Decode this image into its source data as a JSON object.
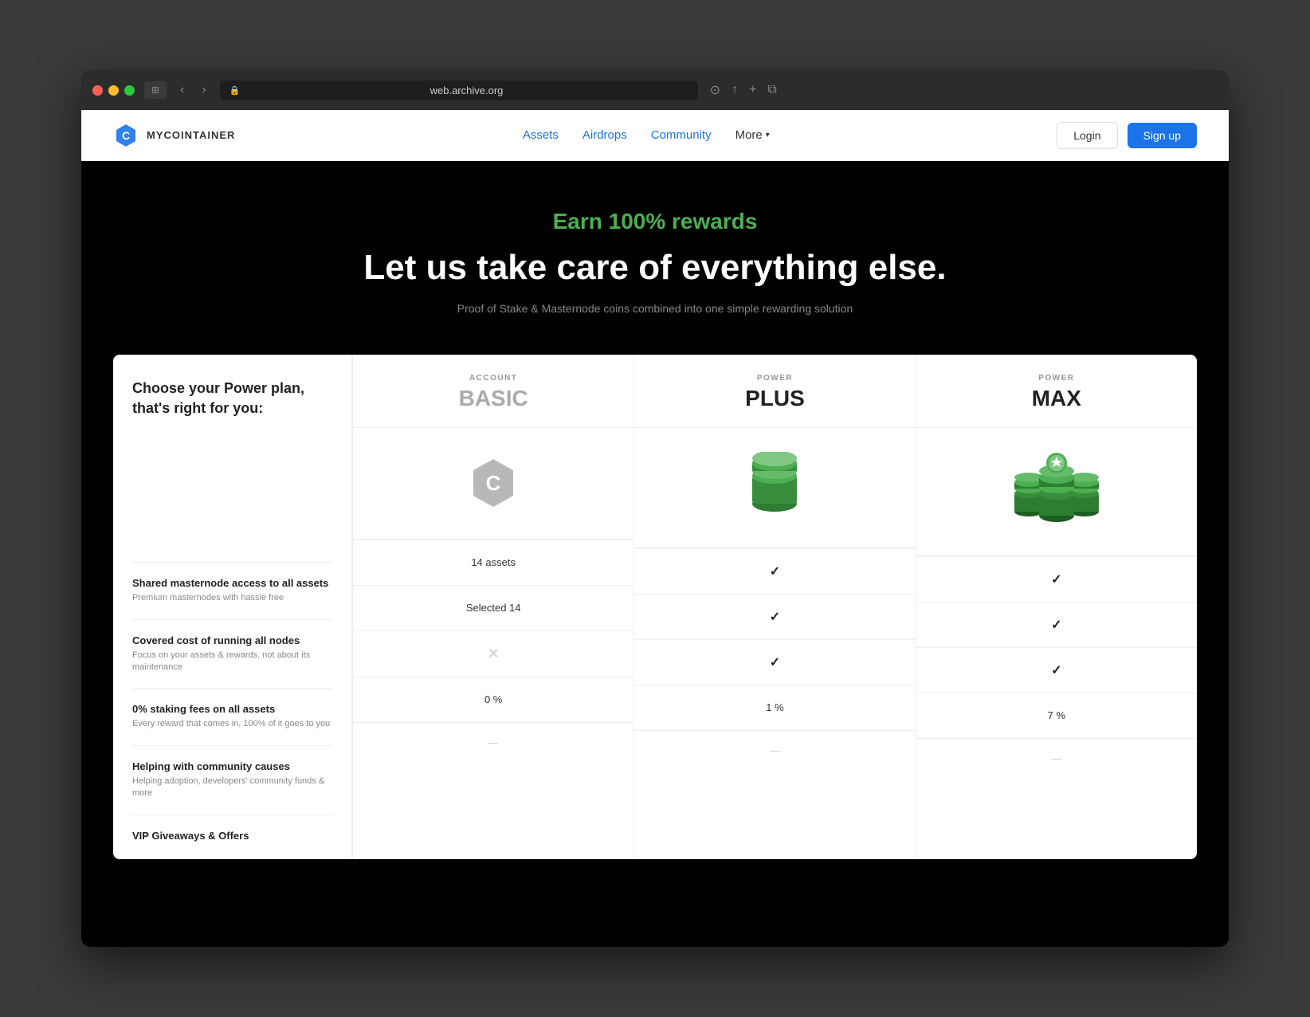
{
  "browser": {
    "url": "web.archive.org"
  },
  "navbar": {
    "logo_text": "MYCOINTAINER",
    "links": {
      "assets": "Assets",
      "airdrops": "Airdrops",
      "community": "Community",
      "more": "More"
    },
    "login": "Login",
    "signup": "Sign up"
  },
  "hero": {
    "subtitle": "Earn 100% rewards",
    "title": "Let us take care of everything else.",
    "description": "Proof of Stake & Masternode coins combined into one simple rewarding solution"
  },
  "pricing": {
    "choose_text": "Choose your Power plan, that's right for you:",
    "plans": [
      {
        "id": "basic",
        "type_label": "ACCOUNT",
        "name": "BASIC"
      },
      {
        "id": "plus",
        "type_label": "POWER",
        "name": "PLUS"
      },
      {
        "id": "max",
        "type_label": "POWER",
        "name": "MAX"
      }
    ],
    "features": [
      {
        "title": "Shared masternode access to all assets",
        "desc": "Premium masternodes with hassle free",
        "basic": "14 assets",
        "plus": "✓",
        "max": "✓"
      },
      {
        "title": "Covered cost of running all nodes",
        "desc": "Focus on your assets & rewards, not about its maintenance",
        "basic": "Selected 14",
        "plus": "✓",
        "max": "✓"
      },
      {
        "title": "0% staking fees on all assets",
        "desc": "Every reward that comes in, 100% of it goes to you",
        "basic": "✗",
        "plus": "✓",
        "max": "✓"
      },
      {
        "title": "Helping with community causes",
        "desc": "Helping adoption, developers' community funds & more",
        "basic": "0 %",
        "plus": "1 %",
        "max": "7 %"
      },
      {
        "title": "VIP Giveaways & Offers",
        "desc": "",
        "basic": "...",
        "plus": "...",
        "max": "..."
      }
    ]
  }
}
